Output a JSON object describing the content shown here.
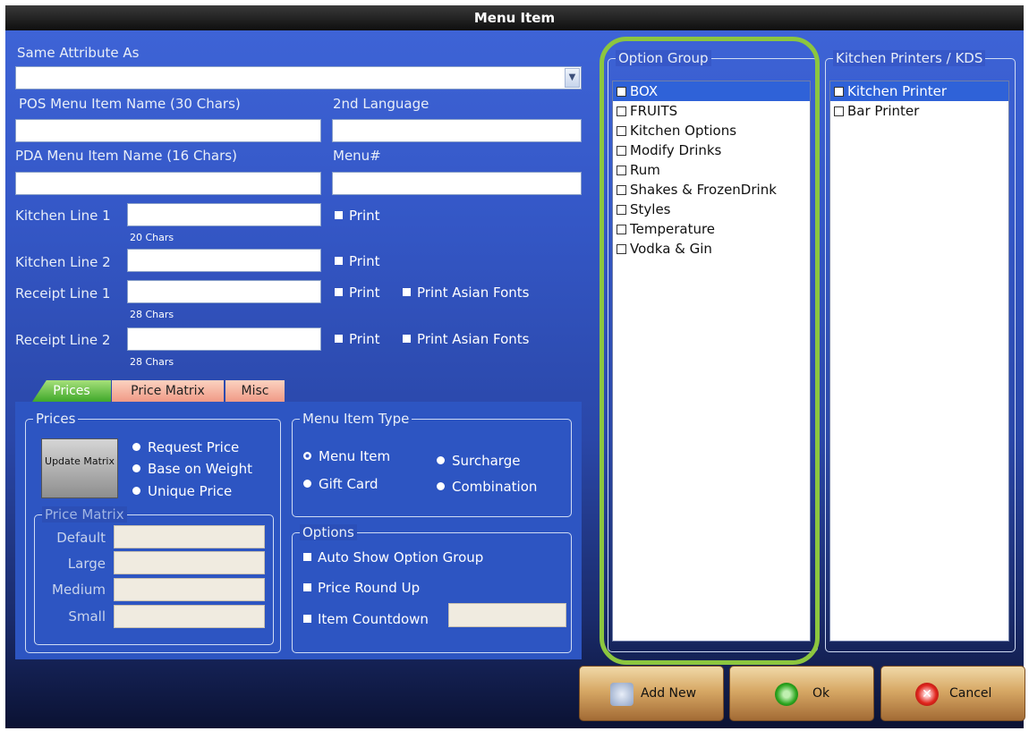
{
  "window": {
    "title": "Menu Item"
  },
  "form": {
    "same_attr_label": "Same Attribute As",
    "pos_name_label": "POS Menu Item Name (30 Chars)",
    "second_lang_label": "2nd Language",
    "pda_name_label": "PDA Menu Item Name (16 Chars)",
    "menu_num_label": "Menu#",
    "kitchen1_label": "Kitchen Line 1",
    "kitchen2_label": "Kitchen Line 2",
    "receipt1_label": "Receipt Line 1",
    "receipt2_label": "Receipt Line 2",
    "chars20": "20 Chars",
    "chars28a": "28 Chars",
    "chars28b": "28 Chars",
    "print": "Print",
    "print_asian": "Print Asian Fonts"
  },
  "tabs": [
    "Prices",
    "Price Matrix",
    "Misc"
  ],
  "prices_group": {
    "title": "Prices",
    "update_matrix": "Update Matrix",
    "radios": [
      "Request Price",
      "Base on Weight",
      "Unique Price"
    ],
    "matrix_title": "Price Matrix",
    "matrix_rows": [
      "Default",
      "Large",
      "Medium",
      "Small"
    ]
  },
  "item_type": {
    "title": "Menu Item Type",
    "options": [
      "Menu Item",
      "Surcharge",
      "Gift Card",
      "Combination"
    ],
    "selected": "Menu Item"
  },
  "options_group": {
    "title": "Options",
    "items": [
      "Auto Show Option Group",
      "Price Round Up",
      "Item Countdown"
    ]
  },
  "option_group_list": {
    "title": "Option Group",
    "items": [
      "BOX",
      "FRUITS",
      "Kitchen Options",
      "Modify Drinks",
      "Rum",
      "Shakes & FrozenDrink",
      "Styles",
      "Temperature",
      "Vodka & Gin"
    ],
    "selected": "BOX"
  },
  "printers_list": {
    "title": "Kitchen Printers / KDS",
    "items": [
      "Kitchen Printer",
      "Bar Printer"
    ],
    "selected": "Kitchen Printer"
  },
  "buttons": {
    "add_new": "Add New",
    "ok": "Ok",
    "cancel": "Cancel"
  },
  "colors": {
    "highlight_ring": "#8cc63f",
    "button_gradient_top": "#f0d9a8",
    "selection": "#2f62d8"
  }
}
